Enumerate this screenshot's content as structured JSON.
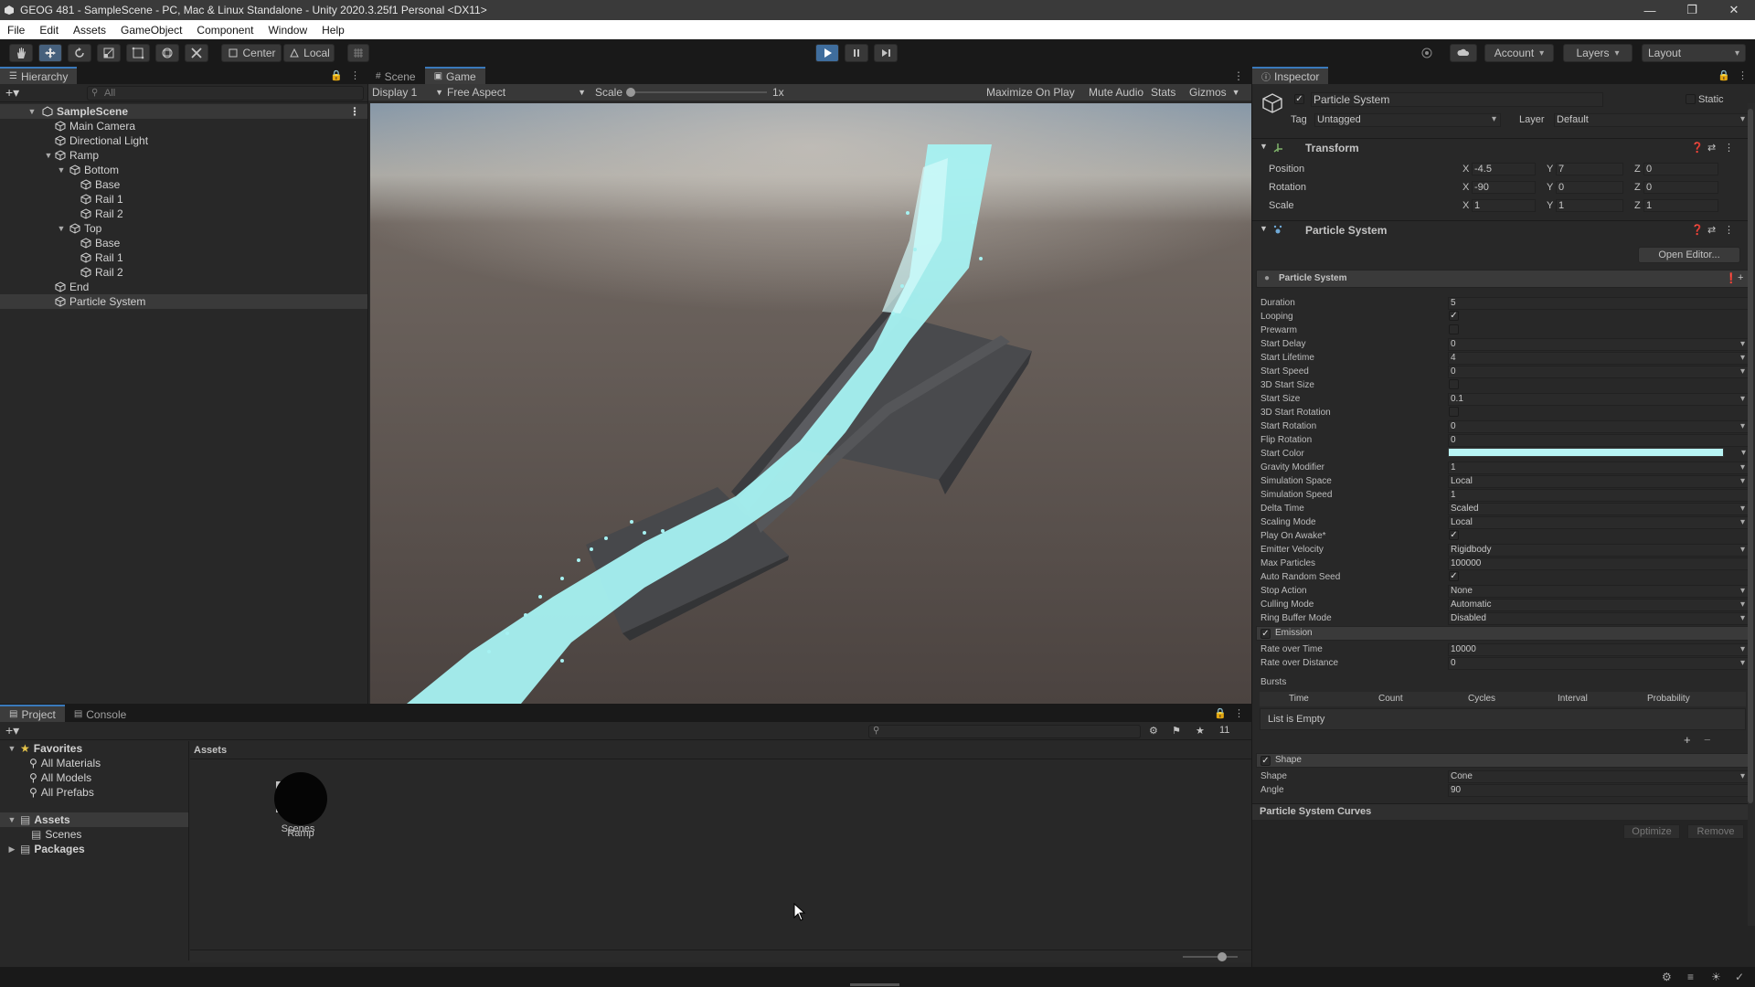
{
  "window": {
    "title": "GEOG 481 - SampleScene - PC, Mac & Linux Standalone - Unity 2020.3.25f1 Personal <DX11>"
  },
  "menu": [
    "File",
    "Edit",
    "Assets",
    "GameObject",
    "Component",
    "Window",
    "Help"
  ],
  "toolbar": {
    "pivot": "Center",
    "space": "Local",
    "account": "Account",
    "layers": "Layers",
    "layout": "Layout"
  },
  "hierarchy": {
    "tab": "Hierarchy",
    "search_placeholder": "All",
    "scene": "SampleScene",
    "items": [
      {
        "label": "Main Camera"
      },
      {
        "label": "Directional Light"
      },
      {
        "label": "Ramp"
      },
      {
        "label": "Bottom"
      },
      {
        "label": "Base"
      },
      {
        "label": "Rail 1"
      },
      {
        "label": "Rail 2"
      },
      {
        "label": "Top"
      },
      {
        "label": "Base"
      },
      {
        "label": "Rail 1"
      },
      {
        "label": "Rail 2"
      },
      {
        "label": "End"
      },
      {
        "label": "Particle System"
      }
    ]
  },
  "gameview": {
    "tabs": [
      "Scene",
      "Game"
    ],
    "display": "Display 1",
    "aspect": "Free Aspect",
    "scale_label": "Scale",
    "scale_value": "1x",
    "maximize": "Maximize On Play",
    "mute": "Mute Audio",
    "stats": "Stats",
    "gizmos": "Gizmos"
  },
  "inspector": {
    "tab": "Inspector",
    "object_name": "Particle System",
    "static_label": "Static",
    "tag_label": "Tag",
    "tag_value": "Untagged",
    "layer_label": "Layer",
    "layer_value": "Default",
    "transform": {
      "title": "Transform",
      "position_label": "Position",
      "pos_x": "-4.5",
      "pos_y": "7",
      "pos_z": "0",
      "rotation_label": "Rotation",
      "rot_x": "-90",
      "rot_y": "0",
      "rot_z": "0",
      "scale_label": "Scale",
      "scl_x": "1",
      "scl_y": "1",
      "scl_z": "1",
      "x": "X",
      "y": "Y",
      "z": "Z"
    },
    "ps_component": {
      "title": "Particle System",
      "open_editor": "Open Editor...",
      "module_title": "Particle System"
    },
    "props": {
      "duration_label": "Duration",
      "duration": "5",
      "looping_label": "Looping",
      "prewarm_label": "Prewarm",
      "start_delay_label": "Start Delay",
      "start_delay": "0",
      "start_lifetime_label": "Start Lifetime",
      "start_lifetime": "4",
      "start_speed_label": "Start Speed",
      "start_speed": "0",
      "start_size_3d_label": "3D Start Size",
      "start_size_label": "Start Size",
      "start_size": "0.1",
      "start_rotation_3d_label": "3D Start Rotation",
      "start_rotation_label": "Start Rotation",
      "start_rotation": "0",
      "flip_rotation_label": "Flip Rotation",
      "flip_rotation": "0",
      "start_color_label": "Start Color",
      "gravity_label": "Gravity Modifier",
      "gravity": "1",
      "sim_space_label": "Simulation Space",
      "sim_space": "Local",
      "sim_speed_label": "Simulation Speed",
      "sim_speed": "1",
      "delta_time_label": "Delta Time",
      "delta_time": "Scaled",
      "scaling_mode_label": "Scaling Mode",
      "scaling_mode": "Local",
      "play_on_awake_label": "Play On Awake*",
      "emitter_velocity_label": "Emitter Velocity",
      "emitter_velocity": "Rigidbody",
      "max_particles_label": "Max Particles",
      "max_particles": "100000",
      "auto_random_seed_label": "Auto Random Seed",
      "stop_action_label": "Stop Action",
      "stop_action": "None",
      "culling_mode_label": "Culling Mode",
      "culling_mode": "Automatic",
      "ring_buffer_label": "Ring Buffer Mode",
      "ring_buffer": "Disabled"
    },
    "emission": {
      "title": "Emission",
      "rate_time_label": "Rate over Time",
      "rate_time": "10000",
      "rate_distance_label": "Rate over Distance",
      "rate_distance": "0",
      "bursts_label": "Bursts",
      "cols": [
        "Time",
        "Count",
        "Cycles",
        "Interval",
        "Probability"
      ],
      "empty": "List is Empty"
    },
    "shape": {
      "title": "Shape",
      "shape_label": "Shape",
      "shape_value": "Cone",
      "angle_label": "Angle",
      "angle_value": "90"
    },
    "curves": {
      "title": "Particle System Curves",
      "optimize": "Optimize",
      "remove": "Remove"
    }
  },
  "project": {
    "tabs": [
      "Project",
      "Console"
    ],
    "favorites": "Favorites",
    "fav_items": [
      "All Materials",
      "All Models",
      "All Prefabs"
    ],
    "assets_root": "Assets",
    "scenes_folder": "Scenes",
    "packages": "Packages",
    "breadcrumb": "Assets",
    "hidden_count": "11",
    "assets": [
      {
        "label": "Scenes"
      },
      {
        "label": "Ramp"
      }
    ]
  },
  "colors": {
    "selection": "#3a79bb",
    "particle": "#a6f2f2",
    "start_color": "#b8f4f4"
  }
}
